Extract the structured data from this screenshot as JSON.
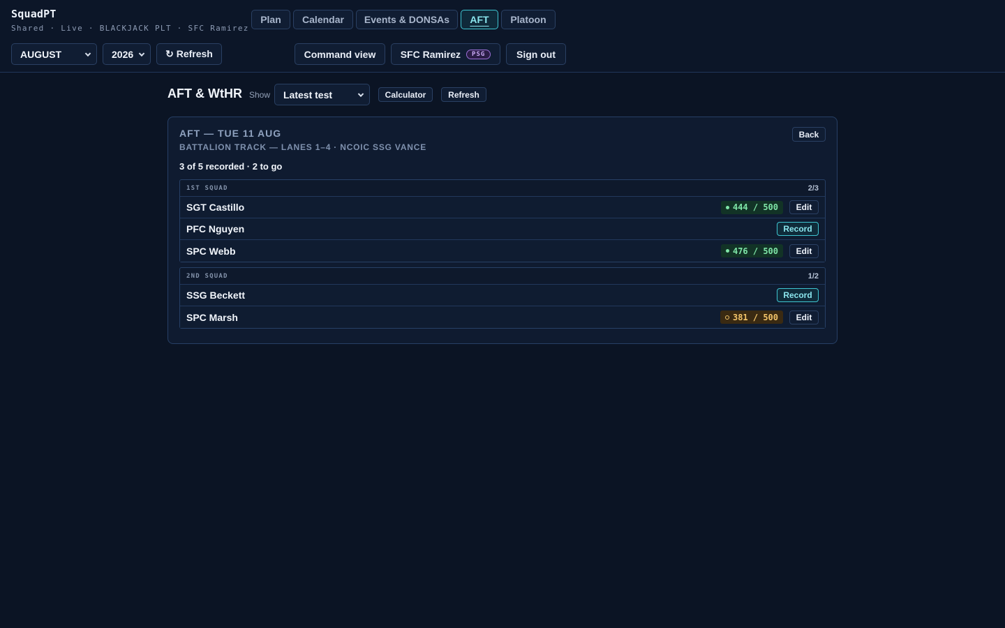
{
  "app": {
    "title": "SquadPT",
    "subtitle": "Shared · Live · BLACKJACK PLT · SFC Ramirez"
  },
  "nav": {
    "tabs": [
      {
        "label": "Plan",
        "active": false
      },
      {
        "label": "Calendar",
        "active": false
      },
      {
        "label": "Events & DONSAs",
        "active": false
      },
      {
        "label": "AFT",
        "active": true
      },
      {
        "label": "Platoon",
        "active": false
      }
    ]
  },
  "controls": {
    "month": "AUGUST",
    "year": "2026",
    "refresh_label": "↻ Refresh",
    "command_view_label": "Command view",
    "user_name": "SFC Ramirez",
    "user_role": "PSG",
    "sign_out_label": "Sign out"
  },
  "page": {
    "title": "AFT & WtHR",
    "show_label": "Show",
    "show_value": "Latest test",
    "calculator_label": "Calculator",
    "refresh_label": "Refresh"
  },
  "event": {
    "title": "AFT — TUE 11 AUG",
    "subtitle": "BATTALION TRACK — LANES 1–4 · NCOIC SSG VANCE",
    "back_label": "Back",
    "summary": "3 of 5 recorded · 2 to go",
    "squads": [
      {
        "name": "1ST SQUAD",
        "count": "2/3",
        "soldiers": [
          {
            "name": "SGT Castillo",
            "score": "444 / 500",
            "status": "pass",
            "action": "Edit"
          },
          {
            "name": "PFC Nguyen",
            "score": "",
            "status": "none",
            "action": "Record"
          },
          {
            "name": "SPC Webb",
            "score": "476 / 500",
            "status": "pass",
            "action": "Edit"
          }
        ]
      },
      {
        "name": "2ND SQUAD",
        "count": "1/2",
        "soldiers": [
          {
            "name": "SSG Beckett",
            "score": "",
            "status": "none",
            "action": "Record"
          },
          {
            "name": "SPC Marsh",
            "score": "381 / 500",
            "status": "warn",
            "action": "Edit"
          }
        ]
      }
    ]
  },
  "colors": {
    "background": "#0b1424",
    "accent": "#3fc6d2",
    "pass": "#7fe6a8",
    "warn": "#f3c56a",
    "role_badge": "#c9a8f5"
  }
}
